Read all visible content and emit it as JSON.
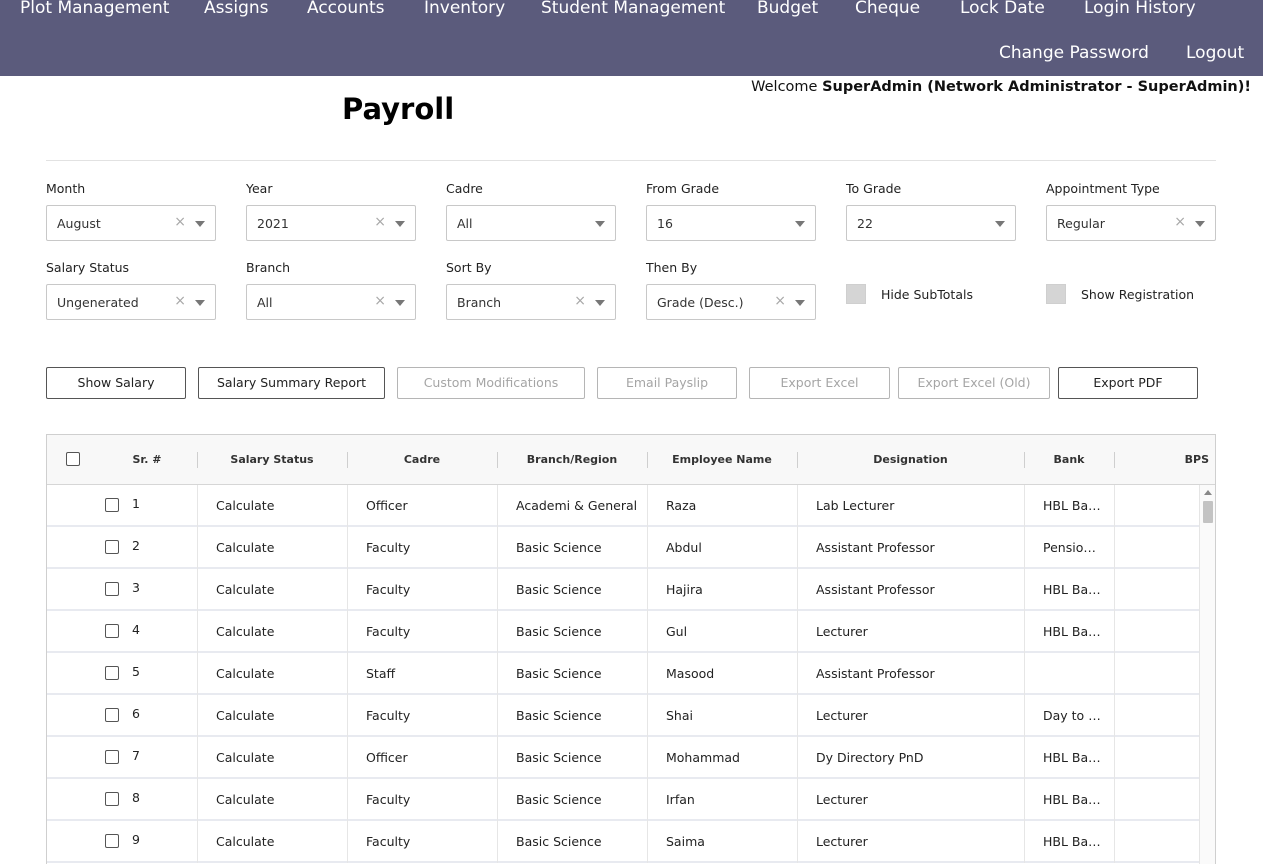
{
  "nav": {
    "row1": [
      "Plot Management",
      "Assigns",
      "Accounts",
      "Inventory",
      "Student Management",
      "Budget",
      "Cheque",
      "Lock Date",
      "Login History"
    ],
    "row2": [
      "Change Password",
      "Logout"
    ]
  },
  "welcome": {
    "prefix": "Welcome ",
    "user": "SuperAdmin (Network Administrator - SuperAdmin)!"
  },
  "page_title": "Payroll",
  "filters": {
    "month": {
      "label": "Month",
      "value": "August",
      "clearable": true
    },
    "year": {
      "label": "Year",
      "value": "2021",
      "clearable": true
    },
    "cadre": {
      "label": "Cadre",
      "value": "All",
      "clearable": false
    },
    "from_grade": {
      "label": "From Grade",
      "value": "16",
      "clearable": false
    },
    "to_grade": {
      "label": "To Grade",
      "value": "22",
      "clearable": false
    },
    "appointment_type": {
      "label": "Appointment Type",
      "value": "Regular",
      "clearable": true
    },
    "salary_status": {
      "label": "Salary Status",
      "value": "Ungenerated",
      "clearable": true
    },
    "branch": {
      "label": "Branch",
      "value": "All",
      "clearable": true
    },
    "sort_by": {
      "label": "Sort By",
      "value": "Branch",
      "clearable": true
    },
    "then_by": {
      "label": "Then By",
      "value": "Grade (Desc.)",
      "clearable": true
    },
    "hide_subtotals": {
      "label": "Hide SubTotals",
      "checked": false
    },
    "show_registration": {
      "label": "Show Registration",
      "checked": false
    },
    "clear_glyph": "×"
  },
  "buttons": {
    "show_salary": "Show Salary",
    "salary_summary_report": "Salary Summary Report",
    "custom_modifications": "Custom Modifications",
    "email_payslip": "Email Payslip",
    "export_excel": "Export Excel",
    "export_excel_old": "Export Excel (Old)",
    "export_pdf": "Export PDF"
  },
  "table": {
    "columns": [
      "Sr. #",
      "Salary Status",
      "Cadre",
      "Branch/Region",
      "Employee Name",
      "Designation",
      "Bank",
      "BPS"
    ],
    "rows": [
      {
        "sr": "1",
        "status": "Calculate",
        "cadre": "Officer",
        "branch": "Academi & General",
        "name": "Raza",
        "designation": "Lab Lecturer",
        "bank": "HBL Bank",
        "bps": ""
      },
      {
        "sr": "2",
        "status": "Calculate",
        "cadre": "Faculty",
        "branch": "Basic Science",
        "name": "Abdul",
        "designation": "Assistant Professor",
        "bank": "Pension Account",
        "bps": ""
      },
      {
        "sr": "3",
        "status": "Calculate",
        "cadre": "Faculty",
        "branch": "Basic Science",
        "name": "Hajira",
        "designation": "Assistant Professor",
        "bank": "HBL Bank",
        "bps": ""
      },
      {
        "sr": "4",
        "status": "Calculate",
        "cadre": "Faculty",
        "branch": "Basic Science",
        "name": "Gul",
        "designation": "Lecturer",
        "bank": "HBL Bank",
        "bps": ""
      },
      {
        "sr": "5",
        "status": "Calculate",
        "cadre": "Staff",
        "branch": "Basic Science",
        "name": "Masood",
        "designation": "Assistant Professor",
        "bank": "",
        "bps": ""
      },
      {
        "sr": "6",
        "status": "Calculate",
        "cadre": "Faculty",
        "branch": "Basic Science",
        "name": "Shai",
        "designation": "Lecturer",
        "bank": "Day to Day",
        "bps": ""
      },
      {
        "sr": "7",
        "status": "Calculate",
        "cadre": "Officer",
        "branch": "Basic Science",
        "name": "Mohammad",
        "designation": "Dy Directory PnD",
        "bank": "HBL Bank",
        "bps": ""
      },
      {
        "sr": "8",
        "status": "Calculate",
        "cadre": "Faculty",
        "branch": "Basic Science",
        "name": "Irfan",
        "designation": "Lecturer",
        "bank": "HBL Bank",
        "bps": ""
      },
      {
        "sr": "9",
        "status": "Calculate",
        "cadre": "Faculty",
        "branch": "Basic Science",
        "name": "Saima",
        "designation": "Lecturer",
        "bank": "HBL Bank",
        "bps": ""
      }
    ]
  }
}
